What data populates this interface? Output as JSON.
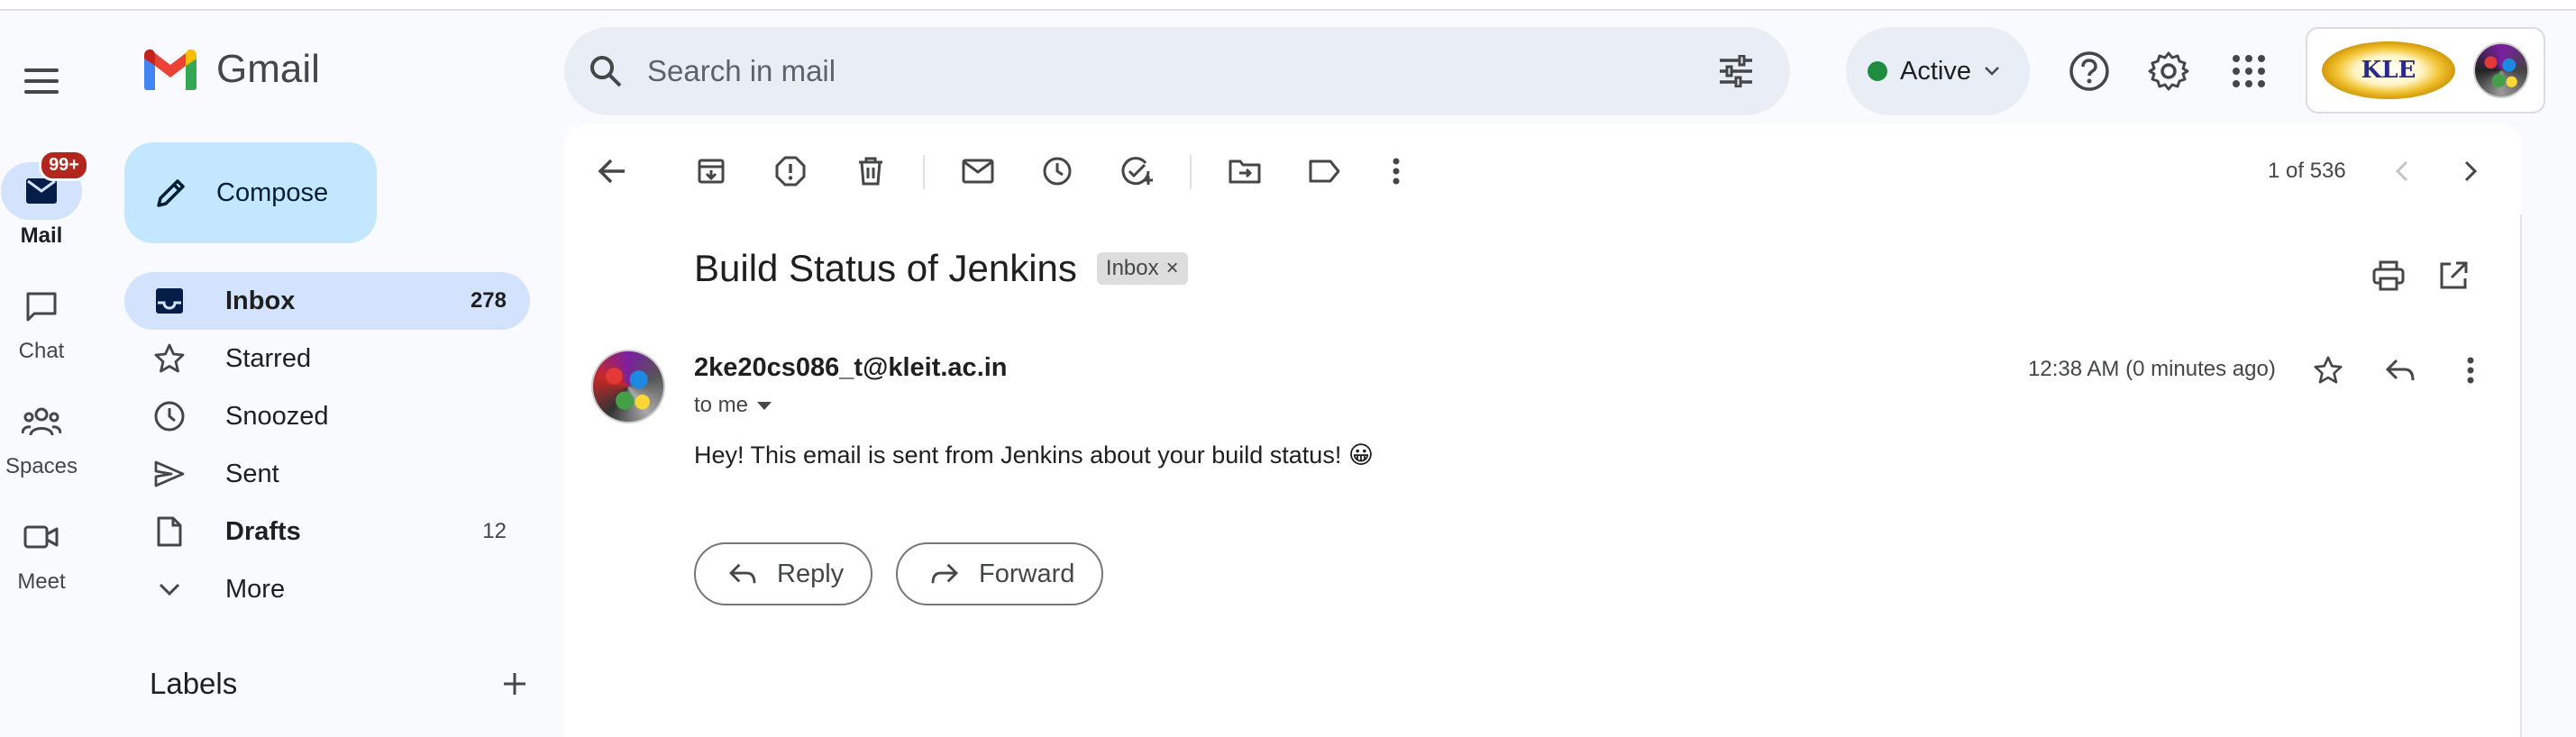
{
  "app": {
    "name": "Gmail"
  },
  "rail": {
    "items": [
      {
        "label": "Mail",
        "badge": "99+",
        "active": true
      },
      {
        "label": "Chat"
      },
      {
        "label": "Spaces"
      },
      {
        "label": "Meet"
      }
    ]
  },
  "sidebar": {
    "compose_label": "Compose",
    "items": [
      {
        "label": "Inbox",
        "count": "278"
      },
      {
        "label": "Starred",
        "count": ""
      },
      {
        "label": "Snoozed",
        "count": ""
      },
      {
        "label": "Sent",
        "count": ""
      },
      {
        "label": "Drafts",
        "count": "12"
      },
      {
        "label": "More",
        "count": ""
      }
    ],
    "labels_heading": "Labels"
  },
  "search": {
    "placeholder": "Search in mail"
  },
  "status": {
    "label": "Active"
  },
  "account": {
    "org_logo_text": "KLE"
  },
  "toolbar": {
    "pager": "1 of 536"
  },
  "email": {
    "subject": "Build Status of Jenkins",
    "chip_label": "Inbox",
    "chip_close": "×",
    "sender": "2ke20cs086_t@kleit.ac.in",
    "recipient": "to me",
    "time": "12:38 AM (0 minutes ago)",
    "body": "Hey! This email is sent from Jenkins about your build status! 😀",
    "reply_label": "Reply",
    "forward_label": "Forward"
  },
  "colors": {
    "accent": "#0b57d0",
    "active_bg": "#d3e3fd",
    "compose_bg": "#c2e7ff",
    "badge": "#b3261e",
    "status_dot": "#1e8e3e"
  }
}
